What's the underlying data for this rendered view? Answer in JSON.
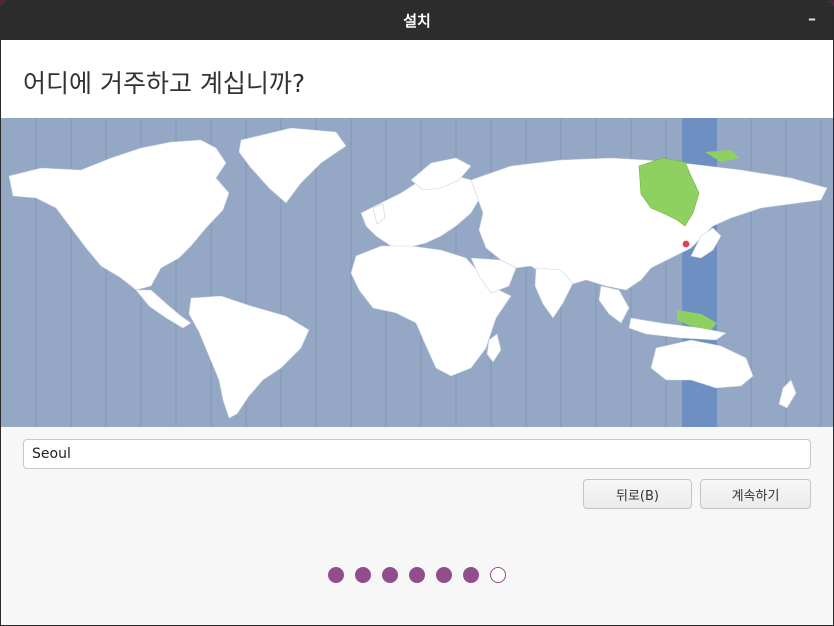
{
  "window": {
    "title": "설치",
    "minimize_glyph": "–"
  },
  "header": {
    "question": "어디에 거주하고 계십니까?"
  },
  "map": {
    "selected_city": "Seoul",
    "highlight_colors": {
      "land": "#ffffff",
      "ocean": "#94a8c5",
      "timezone_band": "#6e8fc2",
      "selected_region": "#8fd160",
      "pin": "#e0405a"
    }
  },
  "location": {
    "value": "Seoul"
  },
  "buttons": {
    "back": "뒤로(B)",
    "continue": "계속하기"
  },
  "progress": {
    "total_steps": 7,
    "completed_steps": 6
  }
}
